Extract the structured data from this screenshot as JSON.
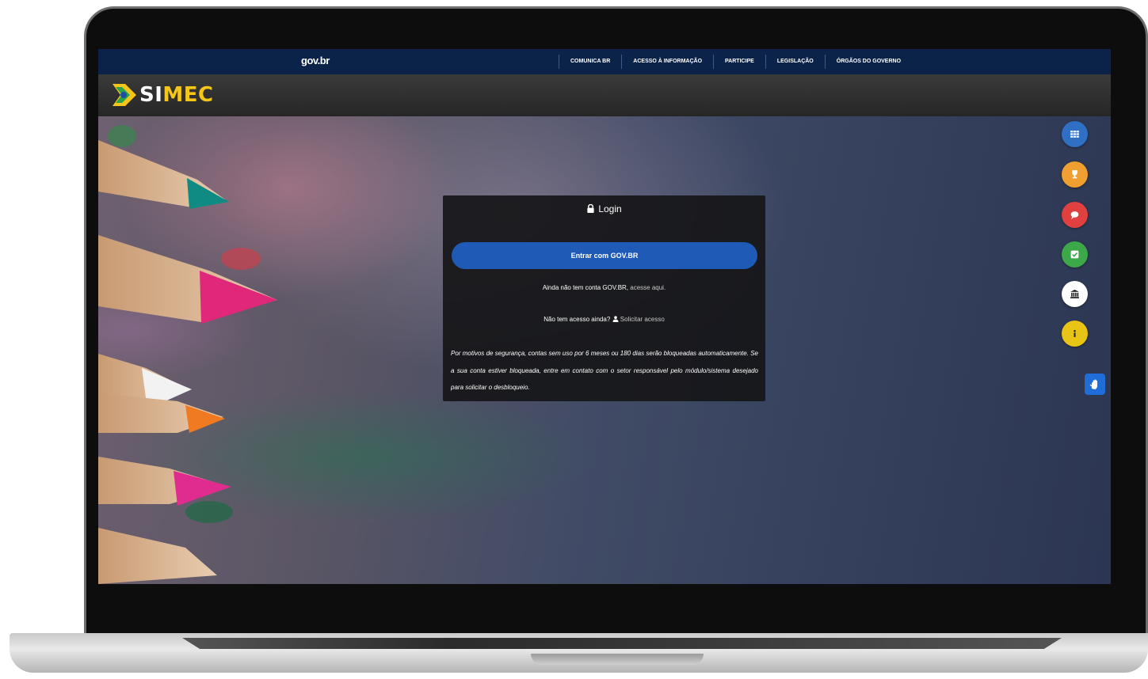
{
  "govbar": {
    "logo": "gov.br",
    "nav": [
      "COMUNICA BR",
      "ACESSO À INFORMAÇÃO",
      "PARTICIPE",
      "LEGISLAÇÃO",
      "ÓRGÃOS DO GOVERNO"
    ]
  },
  "header": {
    "logo_prefix": "SI",
    "logo_suffix": "MEC"
  },
  "login": {
    "title": "Login",
    "govbr_button": "Entrar com GOV.BR",
    "no_account_text": "Ainda não tem conta GOV.BR,",
    "no_account_link": "acesse aqui.",
    "no_access_text": "Não tem acesso ainda?",
    "request_access_link": "Solicitar acesso",
    "security_notice": "Por motivos de segurança, contas sem uso por 6 meses ou 180 dias serão bloqueadas automaticamente. Se a sua conta estiver bloqueada, entre em contato com o setor responsável pelo módulo/sistema desejado para solicitar o desbloqueio."
  },
  "floating_buttons": [
    {
      "icon": "grid-icon",
      "color": "#2f6fc4"
    },
    {
      "icon": "trophy-icon",
      "color": "#f0a030"
    },
    {
      "icon": "chat-icon",
      "color": "#e04040"
    },
    {
      "icon": "check-icon",
      "color": "#3ca84a"
    },
    {
      "icon": "institution-icon",
      "color": "#ffffff"
    },
    {
      "icon": "info-icon",
      "color": "#e8c417"
    }
  ],
  "accessibility": {
    "icon": "sign-language-icon",
    "color": "#1e6dd8"
  }
}
